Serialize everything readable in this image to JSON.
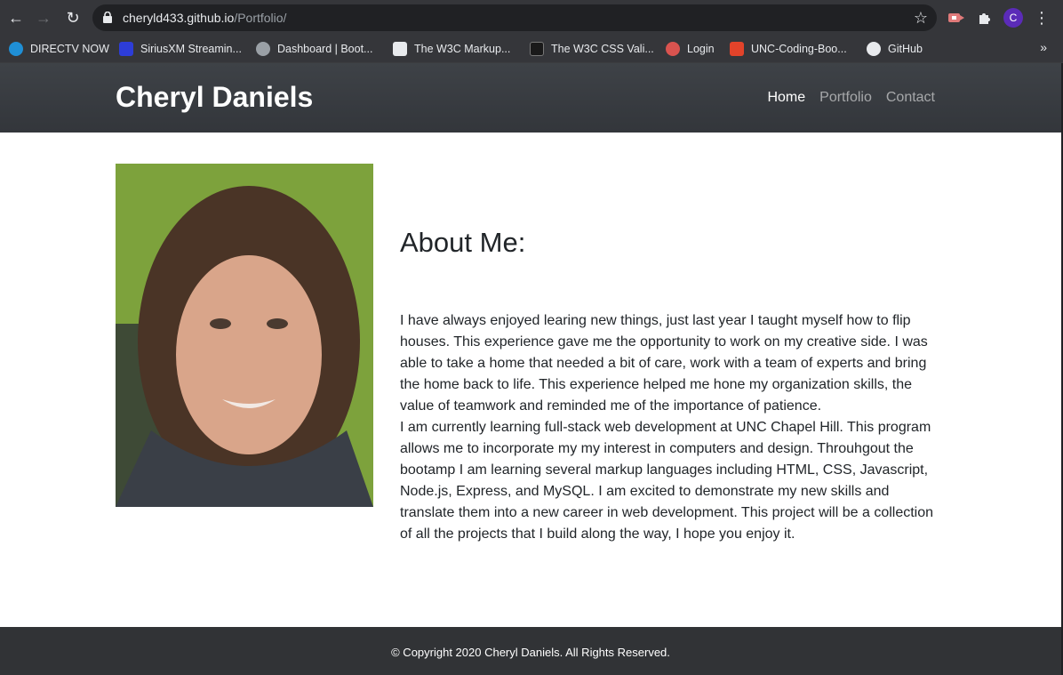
{
  "browser": {
    "url_host": "cheryld433.github.io",
    "url_path": "/Portfolio/",
    "profile_initial": "C",
    "bookmarks": [
      {
        "label": "DIRECTV NOW",
        "icon": "att-globe-icon",
        "color": "#1f8fd6"
      },
      {
        "label": "SiriusXM Streamin...",
        "icon": "siriusxm-icon",
        "color": "#2d3dd8"
      },
      {
        "label": "Dashboard | Boot...",
        "icon": "globe-icon",
        "color": "#9aa0a6"
      },
      {
        "label": "The W3C Markup...",
        "icon": "w3c-icon",
        "color": "#e8eaed"
      },
      {
        "label": "The W3C CSS Vali...",
        "icon": "w3c-css-icon",
        "color": "#1a1a1a"
      },
      {
        "label": "Login",
        "icon": "login-mascot-icon",
        "color": "#d9534f"
      },
      {
        "label": "UNC-Coding-Boo...",
        "icon": "gitlab-icon",
        "color": "#e2432a"
      },
      {
        "label": "GitHub",
        "icon": "github-icon",
        "color": "#e8eaed"
      }
    ]
  },
  "site": {
    "brand": "Cheryl Daniels",
    "nav": [
      {
        "label": "Home",
        "active": true
      },
      {
        "label": "Portfolio",
        "active": false
      },
      {
        "label": "Contact",
        "active": false
      }
    ],
    "about_title": "About Me:",
    "about_paragraphs": [
      "I have always enjoyed learing new things, just last year I taught myself how to flip houses. This experience gave me the opportunity to work on my creative side. I was able to take a home that needed a bit of care, work with a team of experts and bring the home back to life. This experience helped me hone my organization skills, the value of teamwork and reminded me of the importance of patience.",
      "I am currently learning full-stack web development at UNC Chapel Hill. This program allows me to incorporate my my interest in computers and design. Throuhgout the bootamp I am learning several markup languages including HTML, CSS, Javascript, Node.js, Express, and MySQL. I am excited to demonstrate my new skills and translate them into a new career in web development. This project will be a collection of all the projects that I build along the way, I hope you enjoy it."
    ],
    "footer": "© Copyright 2020 Cheryl Daniels. All Rights Reserved."
  }
}
